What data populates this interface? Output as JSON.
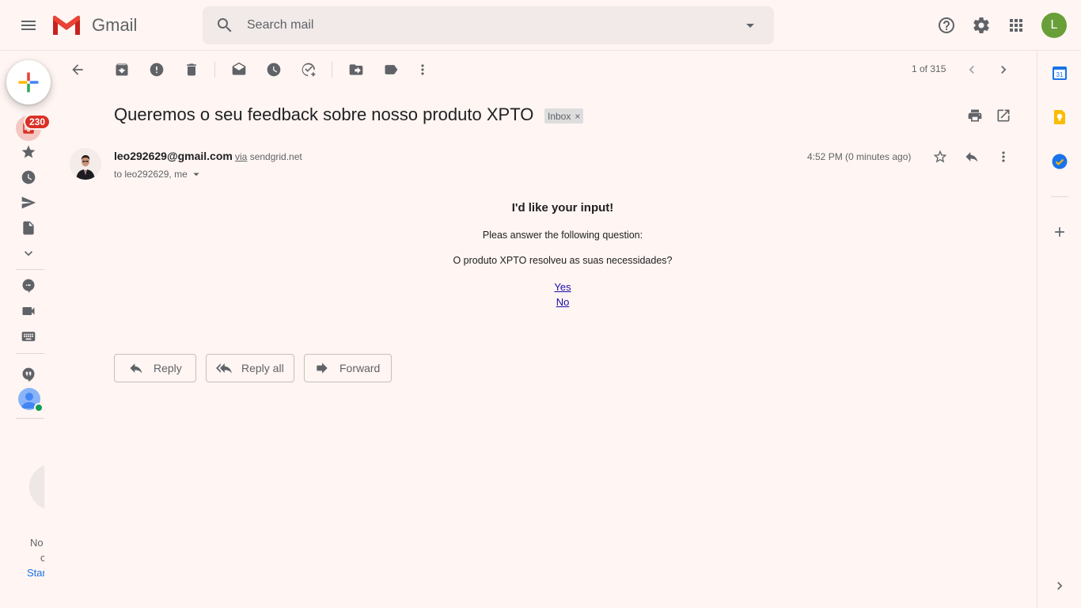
{
  "header": {
    "brand": "Gmail",
    "search_placeholder": "Search mail",
    "account_initial": "L"
  },
  "nav": {
    "inbox_unread_count": "230",
    "cut_text_lines": [
      "No",
      "c",
      "Star"
    ]
  },
  "toolbar": {
    "pager": "1 of 315"
  },
  "email": {
    "subject": "Queremos o seu feedback sobre nosso produto XPTO",
    "label": "Inbox",
    "label_remove": "×",
    "sender_email": "leo292629@gmail.com",
    "via_word": "via",
    "via_domain": "sendgrid.net",
    "recipients": "to leo292629, me",
    "timestamp": "4:52 PM (0 minutes ago)",
    "body": {
      "heading": "I'd like your input!",
      "line1": "Pleas answer the following question:",
      "line2": "O produto XPTO resolveu as suas necessidades?",
      "options": [
        "Yes",
        "No"
      ]
    }
  },
  "actions": {
    "reply": "Reply",
    "reply_all": "Reply all",
    "forward": "Forward"
  },
  "colors": {
    "background": "#fff5f2",
    "badge": "#d93025",
    "avatar": "#689f38",
    "link": "#1a0dab"
  }
}
